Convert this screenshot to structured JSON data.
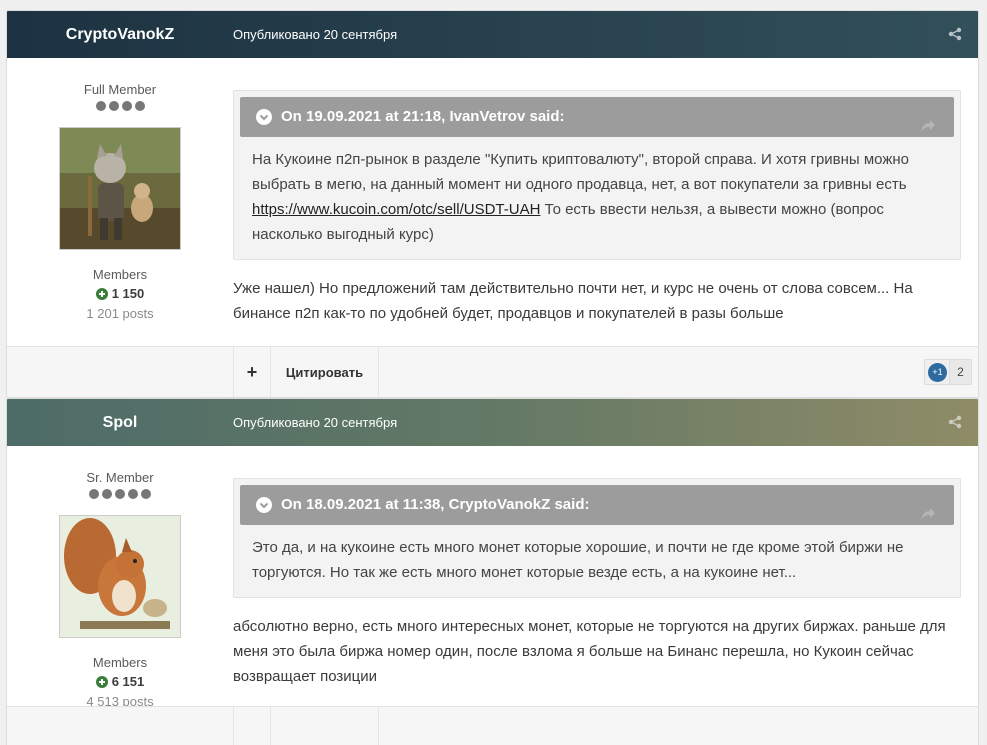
{
  "posts": [
    {
      "author": "CryptoVanokZ",
      "date": "Опубликовано 20 сентября",
      "rank": "Full Member",
      "rank_pips": 4,
      "group": "Members",
      "reputation": "1 150",
      "posts_count": "1 201 posts",
      "quote": {
        "header": "On 19.09.2021 at 21:18, IvanVetrov said:",
        "text_before": "На Кукоине п2п-рынок в разделе \"Купить криптовалюту\", второй справа. И хотя гривны можно выбрать в мегю, на данный момент ни одного продавца, нет, а вот покупатели за гривны есть ",
        "link": "https://www.kucoin.com/otc/sell/USDT-UAH",
        "text_after": " То есть ввести нельзя, а вывести можно (вопрос насколько выгодный курс)"
      },
      "reply": "Уже нашел) Но предложений там действительно почти нет, и курс не очень от слова совсем... На бинансе п2п как-то по удобней будет, продавцов и покупателей в разы больше",
      "footer": {
        "plus_label": "+",
        "quote_label": "Цитировать",
        "reaction_label": "+1",
        "reaction_count": "2"
      }
    },
    {
      "author": "Spol",
      "date": "Опубликовано 20 сентября",
      "rank": "Sr. Member",
      "rank_pips": 5,
      "group": "Members",
      "reputation": "6 151",
      "posts_count": "4 513 posts",
      "quote": {
        "header": "On 18.09.2021 at 11:38, CryptoVanokZ said:",
        "text": "Это да, и на кукоине есть много монет которые хорошие, и почти не где кроме этой биржи не торгуются. Но так же есть много монет которые везде есть, а на кукоине нет..."
      },
      "reply": "абсолютно верно, есть много интересных монет, которые не торгуются на других биржах. раньше для меня это была биржа номер один, после взлома я больше на Бинанс перешла,  но Кукоин сейчас возвращает позиции"
    }
  ],
  "icons": {
    "share": "share-icon",
    "quote_toggle": "chevron-down-icon",
    "quote_share": "share-arrow-icon",
    "reputation": "plus-circle-icon"
  },
  "colors": {
    "header_1": "#1d3242",
    "header_2": "#637966",
    "quote_head": "#9c9c9c",
    "reputation_icon": "#3a7d3a",
    "reaction": "#2c6aa0"
  }
}
